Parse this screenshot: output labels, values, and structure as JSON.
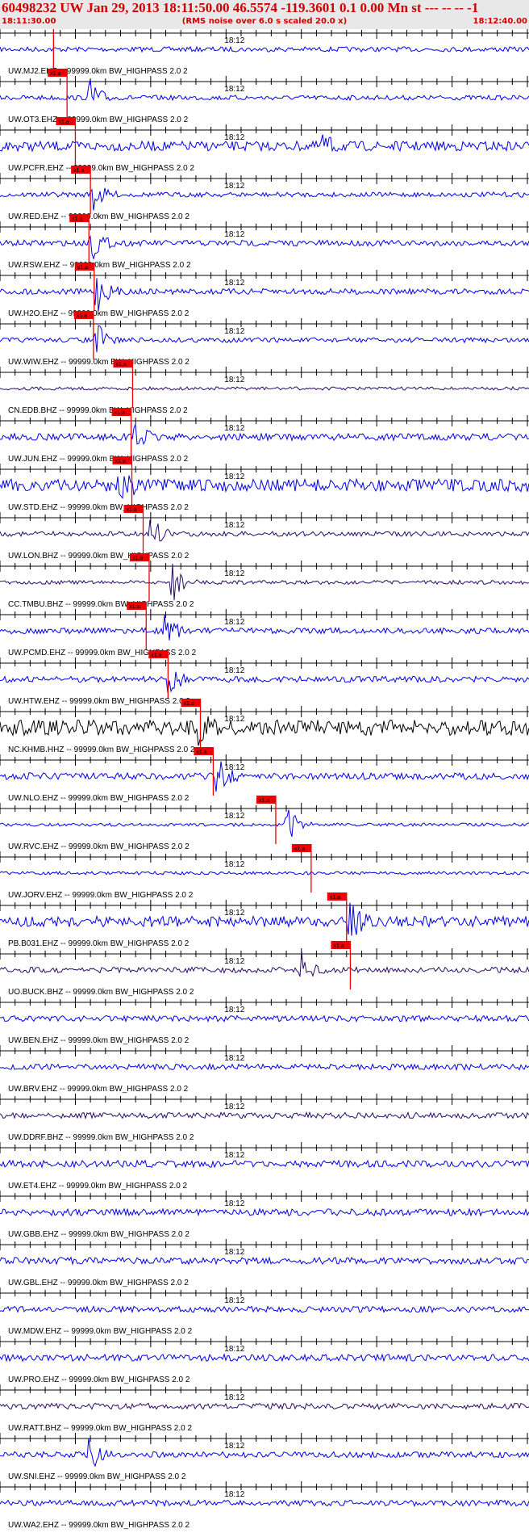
{
  "header": {
    "title": "60498232 UW Jan 29, 2013 18:11:50.00   46.5574 -119.3601  0.1 0.00 Mn st --- -- --   -1",
    "start_time": "18:11:30.00",
    "rms_note": "(RMS noise over 6.0 s scaled 20.0 x)",
    "end_time": "18:12:40.00"
  },
  "colors": {
    "trace_blue": "#0000ee",
    "trace_purple": "#2a0a6a",
    "trace_black": "#000000",
    "pick_red": "#ee0000",
    "header_red": "#cc0000"
  },
  "chart_data": {
    "type": "line",
    "x_range": [
      "18:11:30.00",
      "18:12:40.00"
    ],
    "center_tick_label": "18:12",
    "pick_label": "x1.a",
    "filter_label": "99999.0km BW_HIGHPASS  2.0  2",
    "traces": [
      {
        "station": "UW.MJ2.EHZ",
        "pick": "18:11:37.1",
        "event": null,
        "color": "blue",
        "noise": 0.25
      },
      {
        "station": "UW.OT3.EHZ",
        "pick": "18:11:38.9",
        "event": "18:11:42.2",
        "color": "blue",
        "noise": 0.25
      },
      {
        "station": "UW.PCFR.EHZ",
        "pick": "18:11:40.0",
        "event": "18:12:12.4",
        "color": "blue",
        "noise": 0.5
      },
      {
        "station": "UW.RED.EHZ",
        "pick": "18:11:42.0",
        "event": "18:11:42.4",
        "color": "blue",
        "noise": 0.25
      },
      {
        "station": "UW.RSW.EHZ",
        "pick": "18:11:41.8",
        "event": "18:11:42.2",
        "color": "blue",
        "noise": 0.3
      },
      {
        "station": "UW.H2O.EHZ",
        "pick": "18:11:42.5",
        "event": "18:11:43.0",
        "color": "blue",
        "noise": 0.3
      },
      {
        "station": "UW.WIW.EHZ",
        "pick": "18:11:42.4",
        "event": "18:11:42.9",
        "color": "blue",
        "noise": 0.25
      },
      {
        "station": "CN.EDB.BHZ",
        "pick": "18:11:47.6",
        "event": null,
        "color": "purple",
        "noise": 0.15
      },
      {
        "station": "UW.JUN.EHZ",
        "pick": "18:11:47.4",
        "event": "18:11:48.0",
        "color": "blue",
        "noise": 0.35
      },
      {
        "station": "UW.STD.EHZ",
        "pick": "18:11:47.5",
        "event": "18:11:46.0",
        "color": "blue",
        "noise": 0.65
      },
      {
        "station": "UW.LON.BHZ",
        "pick": "18:11:49.0",
        "event": "18:11:50.3",
        "color": "purple",
        "noise": 0.25
      },
      {
        "station": "CC.TMBU.BHZ",
        "pick": "18:11:49.8",
        "event": "18:11:53.1",
        "color": "purple",
        "noise": 0.2
      },
      {
        "station": "UW.PCMD.EHZ",
        "pick": "18:11:49.4",
        "event": "18:11:52.0",
        "color": "blue",
        "noise": 0.3
      },
      {
        "station": "UW.HTW.EHZ",
        "pick": "18:11:52.3",
        "event": "18:11:52.5",
        "color": "blue",
        "noise": 0.3
      },
      {
        "station": "NC.KHMB.HHZ",
        "pick": "18:11:56.6",
        "event": "18:11:56.6",
        "color": "black",
        "noise": 0.8
      },
      {
        "station": "UW.NLO.EHZ",
        "pick": "18:11:58.3",
        "event": "18:11:59.0",
        "color": "blue",
        "noise": 0.35
      },
      {
        "station": "UW.RVC.EHZ",
        "pick": "18:12:06.6",
        "event": "18:12:08.3",
        "color": "blue",
        "noise": 0.15
      },
      {
        "station": "UW.JORV.EHZ",
        "pick": "18:12:11.3",
        "event": null,
        "color": "blue",
        "noise": 0.15
      },
      {
        "station": "PB.B031.EHZ",
        "pick": "18:12:16.0",
        "event": "18:12:16.5",
        "color": "blue",
        "noise": 0.55
      },
      {
        "station": "UO.BUCK.BHZ",
        "pick": "18:12:16.5",
        "event": "18:12:10.0",
        "color": "purple",
        "noise": 0.3
      },
      {
        "station": "UW.BEN.EHZ",
        "pick": null,
        "event": null,
        "color": "blue",
        "noise": 0.3
      },
      {
        "station": "UW.BRV.EHZ",
        "pick": null,
        "event": null,
        "color": "blue",
        "noise": 0.3
      },
      {
        "station": "UW.DDRF.BHZ",
        "pick": null,
        "event": null,
        "color": "purple",
        "noise": 0.3
      },
      {
        "station": "UW.ET4.EHZ",
        "pick": null,
        "event": null,
        "color": "blue",
        "noise": 0.35
      },
      {
        "station": "UW.GBB.EHZ",
        "pick": null,
        "event": null,
        "color": "blue",
        "noise": 0.35
      },
      {
        "station": "UW.GBL.EHZ",
        "pick": null,
        "event": null,
        "color": "blue",
        "noise": 0.35
      },
      {
        "station": "UW.MDW.EHZ",
        "pick": null,
        "event": null,
        "color": "blue",
        "noise": 0.3
      },
      {
        "station": "UW.PRO.EHZ",
        "pick": null,
        "event": null,
        "color": "blue",
        "noise": 0.35
      },
      {
        "station": "UW.RATT.BHZ",
        "pick": null,
        "event": null,
        "color": "purple",
        "noise": 0.3
      },
      {
        "station": "UW.SNI.EHZ",
        "pick": null,
        "event": "18:11:42.0",
        "color": "blue",
        "noise": 0.3
      },
      {
        "station": "UW.WA2.EHZ",
        "pick": null,
        "event": null,
        "color": "blue",
        "noise": 0.3
      }
    ]
  }
}
